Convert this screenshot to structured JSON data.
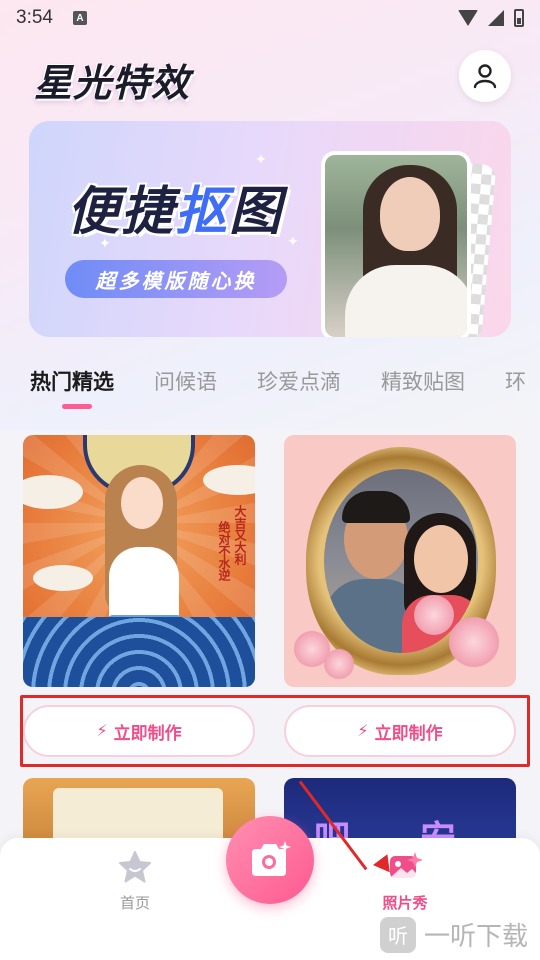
{
  "status_bar": {
    "time": "3:54",
    "notification_icon": "A"
  },
  "header": {
    "app_title": "星光特效",
    "profile_icon": "user-icon"
  },
  "banner": {
    "headline_part1": "便捷",
    "headline_highlight": "抠",
    "headline_part2": "图",
    "subtitle": "超多模版随心换"
  },
  "tabs": [
    {
      "label": "热门精选",
      "active": true
    },
    {
      "label": "问候语",
      "active": false
    },
    {
      "label": "珍爱点滴",
      "active": false
    },
    {
      "label": "精致贴图",
      "active": false
    },
    {
      "label": "环",
      "active": false
    }
  ],
  "cards": {
    "left_text_1": "大吉又大利",
    "left_text_2": "绝对不水逆",
    "make_button_left": "立即制作",
    "make_button_right": "立即制作",
    "bottom_right_text": "吧 安"
  },
  "tabbar": {
    "home_label": "首页",
    "photo_label": "照片秀"
  },
  "watermark": {
    "logo": "听",
    "text": "一听下载"
  },
  "colors": {
    "accent": "#f04e8a",
    "highlight_box": "#e02a2a"
  }
}
